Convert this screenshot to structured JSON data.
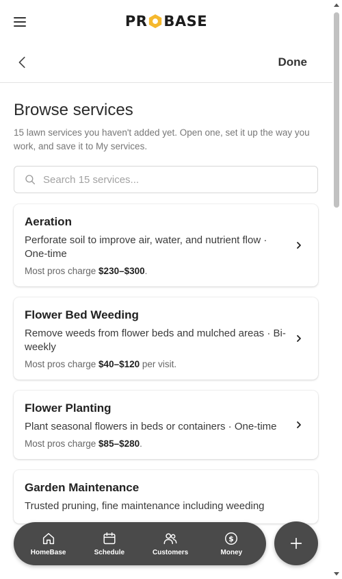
{
  "header": {
    "logo_text_left": "PR",
    "logo_text_right": "BASE",
    "brand_accent": "#f5b82e",
    "menu_icon": "hamburger-menu-icon"
  },
  "subheader": {
    "back_icon": "chevron-left-icon",
    "done_label": "Done"
  },
  "page": {
    "title": "Browse services",
    "description": "15 lawn services you haven't added yet. Open one, set it up the way you work, and save it to My services."
  },
  "search": {
    "placeholder": "Search 15 services..."
  },
  "services": [
    {
      "title": "Aeration",
      "description": "Perforate soil to improve air, water, and nutrient flow · One-time",
      "price_prefix": "Most pros charge ",
      "price": "$230–$300",
      "price_suffix": "."
    },
    {
      "title": "Flower Bed Weeding",
      "description": "Remove weeds from flower beds and mulched areas · Bi-weekly",
      "price_prefix": "Most pros charge ",
      "price": "$40–$120",
      "price_suffix": " per visit."
    },
    {
      "title": "Flower Planting",
      "description": "Plant seasonal flowers in beds or containers · One-time",
      "price_prefix": "Most pros charge ",
      "price": "$85–$280",
      "price_suffix": "."
    },
    {
      "title": "Garden Maintenance",
      "description": "Trusted pruning, fine maintenance including weeding",
      "price_prefix": "",
      "price": "",
      "price_suffix": ""
    }
  ],
  "bottom_nav": {
    "items": [
      {
        "label": "HomeBase",
        "icon": "home-icon"
      },
      {
        "label": "Schedule",
        "icon": "calendar-icon"
      },
      {
        "label": "Customers",
        "icon": "users-icon"
      },
      {
        "label": "Money",
        "icon": "dollar-circle-icon"
      }
    ]
  },
  "fab": {
    "icon": "plus-icon"
  },
  "colors": {
    "nav_bg": "#4a4a4a",
    "text_primary": "#222222",
    "text_muted": "#777777"
  }
}
